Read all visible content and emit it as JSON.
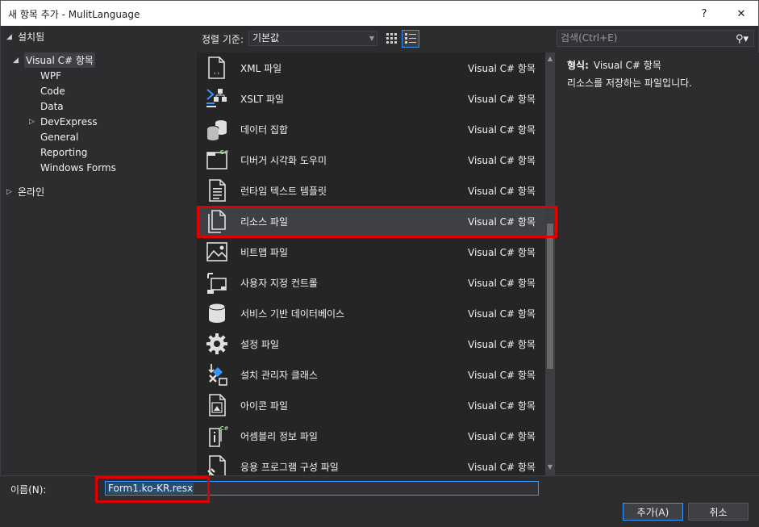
{
  "window": {
    "title": "새 항목 추가 - MulitLanguage",
    "help_label": "?",
    "close_label": "✕"
  },
  "tree": {
    "installed": "설치됨",
    "visual_cs": "Visual C# 항목",
    "children": [
      "WPF",
      "Code",
      "Data",
      "DevExpress",
      "General",
      "Reporting",
      "Windows Forms"
    ],
    "online": "온라인"
  },
  "toolbar": {
    "sort_label": "정렬 기준:",
    "sort_value": "기본값",
    "search_placeholder": "검색(Ctrl+E)"
  },
  "items": [
    {
      "name": "XML 파일",
      "category": "Visual C# 항목",
      "icon": "xml-file-icon"
    },
    {
      "name": "XSLT 파일",
      "category": "Visual C# 항목",
      "icon": "xslt-file-icon"
    },
    {
      "name": "데이터 집합",
      "category": "Visual C# 항목",
      "icon": "dataset-icon"
    },
    {
      "name": "디버거 시각화 도우미",
      "category": "Visual C# 항목",
      "icon": "debugger-visualizer-icon"
    },
    {
      "name": "런타임 텍스트 템플릿",
      "category": "Visual C# 항목",
      "icon": "text-template-icon"
    },
    {
      "name": "리소스 파일",
      "category": "Visual C# 항목",
      "icon": "resource-file-icon"
    },
    {
      "name": "비트맵 파일",
      "category": "Visual C# 항목",
      "icon": "bitmap-file-icon"
    },
    {
      "name": "사용자 지정 컨트롤",
      "category": "Visual C# 항목",
      "icon": "custom-control-icon"
    },
    {
      "name": "서비스 기반 데이터베이스",
      "category": "Visual C# 항목",
      "icon": "database-icon"
    },
    {
      "name": "설정 파일",
      "category": "Visual C# 항목",
      "icon": "settings-file-icon"
    },
    {
      "name": "설치 관리자 클래스",
      "category": "Visual C# 항목",
      "icon": "installer-class-icon"
    },
    {
      "name": "아이콘 파일",
      "category": "Visual C# 항목",
      "icon": "icon-file-icon"
    },
    {
      "name": "어셈블리 정보 파일",
      "category": "Visual C# 항목",
      "icon": "assembly-info-icon"
    },
    {
      "name": "응용 프로그램 구성 파일",
      "category": "Visual C# 항목",
      "icon": "app-config-icon"
    }
  ],
  "details": {
    "type_label": "형식:",
    "type_value": "Visual C# 항목",
    "description": "리소스를 저장하는 파일입니다."
  },
  "bottom": {
    "name_label": "이름(N):",
    "name_value": "Form1.ko-KR.resx",
    "add_label": "추가(A)",
    "cancel_label": "취소"
  },
  "colors": {
    "background": "#2d2d30",
    "list_background": "#252526",
    "selection": "#3f3f46",
    "accent": "#3399ff",
    "highlight_red": "#e00000"
  }
}
